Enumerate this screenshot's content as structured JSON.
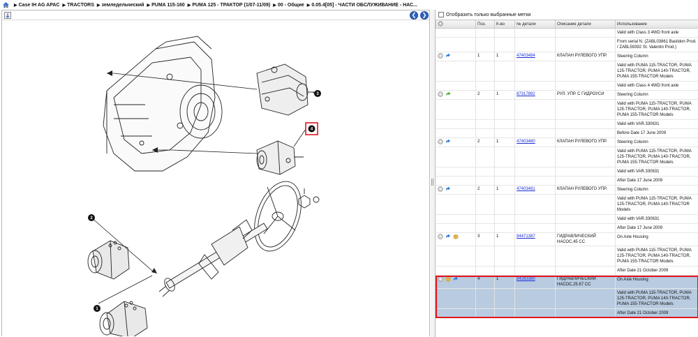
{
  "breadcrumb": [
    "Case IH AG APAC",
    "TRACTORS",
    "земледельческий",
    "PUMA 115-160",
    "PUMA 125 - ТРАКТОР (1/07-11/09)",
    "00 - Общие",
    "0.05.4[05] - ЧАСТИ ОБСЛУЖИВАНИЕ - НАС..."
  ],
  "colors": {
    "accent": "#2f63bd",
    "selection": "#b8cbe0",
    "highlight_border": "#e0141e",
    "link": "#1a2cd6"
  },
  "icons": {
    "home": "home-icon",
    "nav_prev": "arrow-left-icon",
    "nav_next": "arrow-right-icon"
  },
  "diagram": {
    "callouts": [
      "1",
      "2",
      "3",
      "4"
    ]
  },
  "filter": {
    "label": "Отобразить только выбранные метки",
    "checked": false
  },
  "table": {
    "headers": [
      "",
      "Поз.",
      "К-во",
      "№ детали",
      "Описание детали",
      "Использование"
    ],
    "rows": [
      {
        "type": "cont",
        "usage": "Valid with Class 3 4WD front axle"
      },
      {
        "type": "cont",
        "usage": "From serial N. (ZABL03861 Basildon Prod. / ZABL59392 St. Valentin Prod.)"
      },
      {
        "type": "main",
        "icons": [
          "circle",
          "arrow-blue"
        ],
        "pos": "1",
        "qty": "1",
        "part": "47403484",
        "desc": "КЛАПАН РУЛЕВОГО УПР.",
        "usage": "Steering Column"
      },
      {
        "type": "cont",
        "usage": "Valid with PUMA 115-TRACTOR, PUMA 125-TRACTOR, PUMA 140-TRACTOR, PUMA 155-TRACTOR Models"
      },
      {
        "type": "cont",
        "usage": "Valid with Class 4 4WD front axle"
      },
      {
        "type": "main",
        "icons": [
          "circle",
          "arrow-green"
        ],
        "pos": "2",
        "qty": "1",
        "part": "87317892",
        "desc": "РУЛ. УПР. С ГИДРОУСИ",
        "usage": "Steering Column"
      },
      {
        "type": "cont",
        "usage": "Valid with PUMA 115-TRACTOR, PUMA 125-TRACTOR, PUMA 140-TRACTOR, PUMA 155-TRACTOR Models"
      },
      {
        "type": "cont",
        "usage": "Valid with VAR.330631"
      },
      {
        "type": "cont",
        "usage": "Before Date 17 June 2009"
      },
      {
        "type": "main",
        "icons": [
          "circle",
          "arrow-blue"
        ],
        "pos": "2",
        "qty": "1",
        "part": "47403480",
        "desc": "КЛАПАН РУЛЕВОГО УПР.",
        "usage": "Steering Column"
      },
      {
        "type": "cont",
        "usage": "Valid with PUMA 115-TRACTOR, PUMA 125-TRACTOR, PUMA 140-TRACTOR, PUMA 155-TRACTOR Models"
      },
      {
        "type": "cont",
        "usage": "Valid with VAR.330631"
      },
      {
        "type": "cont",
        "usage": "After Date 17 June 2009"
      },
      {
        "type": "main",
        "icons": [
          "circle",
          "arrow-blue"
        ],
        "pos": "2",
        "qty": "1",
        "part": "47403481",
        "desc": "КЛАПАН РУЛЕВОГО УПР.",
        "usage": "Steering Column"
      },
      {
        "type": "cont",
        "usage": "Valid with PUMA 115-TRACTOR, PUMA 125-TRACTOR, PUMA 140-TRACTOR Models"
      },
      {
        "type": "cont",
        "usage": "Valid with VAR.330631"
      },
      {
        "type": "cont",
        "usage": "After Date 17 June 2009"
      },
      {
        "type": "main",
        "icons": [
          "circle",
          "arrow-blue",
          "box"
        ],
        "pos": "3",
        "qty": "1",
        "part": "84471387",
        "desc": "ГИДРАВЛИЧЕСКИЙ НАСОС,45 CC",
        "usage": "On Axle Housing"
      },
      {
        "type": "cont",
        "usage": "Valid with PUMA 115-TRACTOR, PUMA 125-TRACTOR, PUMA 140-TRACTOR, PUMA 155-TRACTOR Models"
      },
      {
        "type": "cont",
        "usage": "After Date 21 October 2009"
      },
      {
        "type": "main",
        "selected": true,
        "icons": [
          "circle",
          "box",
          "arrow-blue"
        ],
        "pos": "4",
        "qty": "1",
        "part": "84283380",
        "desc": "ГИДРАВЛИЧЕСКИЙ НАСОС,25.67 CC",
        "usage": "On Axle Housing"
      },
      {
        "type": "cont",
        "selected": true,
        "usage": "Valid with PUMA 115-TRACTOR, PUMA 125-TRACTOR, PUMA 140-TRACTOR, PUMA 155-TRACTOR Models"
      },
      {
        "type": "cont",
        "selected": true,
        "usage": "After Date 21 October 2009"
      }
    ]
  }
}
